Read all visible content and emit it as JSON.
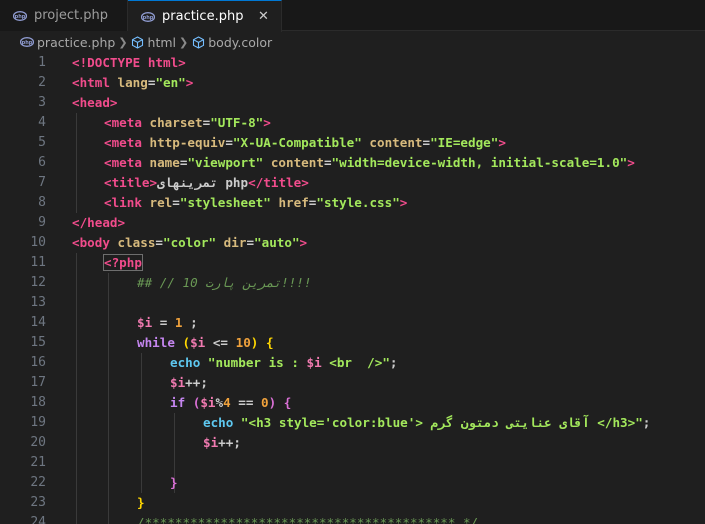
{
  "tabs": [
    {
      "label": "project.php",
      "active": false
    },
    {
      "label": "practice.php",
      "active": true,
      "close": "✕"
    }
  ],
  "breadcrumb": [
    {
      "label": "practice.php"
    },
    {
      "label": "html"
    },
    {
      "label": "body.color"
    }
  ],
  "colors": {
    "accent": "#0078d4",
    "editor_bg": "#1f1f1f",
    "tab_bg": "#181818"
  },
  "line_numbers": [
    "1",
    "2",
    "3",
    "4",
    "5",
    "6",
    "7",
    "8",
    "9",
    "10",
    "11",
    "12",
    "13",
    "14",
    "15",
    "16",
    "17",
    "18",
    "19",
    "20",
    "21",
    "22",
    "23",
    "24"
  ],
  "code": {
    "l1": {
      "a": "<!DOCTYPE",
      "b": " html",
      "c": ">"
    },
    "l2": {
      "a": "<html",
      "b": " lang",
      "c": "=",
      "d": "\"en\"",
      "e": ">"
    },
    "l3": {
      "a": "<head",
      "b": ">"
    },
    "l4": {
      "a": "<meta",
      "b": " charset",
      "c": "=",
      "d": "\"UTF-8\"",
      "e": ">"
    },
    "l5": {
      "a": "<meta",
      "b": " http-equiv",
      "c": "=",
      "d": "\"X-UA-Compatible\"",
      "e": " content",
      "f": "=",
      "g": "\"IE=edge\"",
      "h": ">"
    },
    "l6": {
      "a": "<meta",
      "b": " name",
      "c": "=",
      "d": "\"viewport\"",
      "e": " content",
      "f": "=",
      "g": "\"width=device-width, initial-scale=1.0\"",
      "h": ">"
    },
    "l7": {
      "a": "<title",
      "b": ">",
      "c": "تمرینهای php",
      "d": "</title",
      "e": ">"
    },
    "l8": {
      "a": "<link",
      "b": " rel",
      "c": "=",
      "d": "\"stylesheet\"",
      "e": " href",
      "f": "=",
      "g": "\"style.css\"",
      "h": ">"
    },
    "l9": {
      "a": "</head",
      "b": ">"
    },
    "l10": {
      "a": "<body",
      "b": " class",
      "c": "=",
      "d": "\"color\"",
      "e": " dir",
      "f": "=",
      "g": "\"auto\"",
      "h": ">"
    },
    "l11": {
      "a": "<?php"
    },
    "l12": {
      "a": "## // 10 تمرین پارت!!!!"
    },
    "l14": {
      "a": "$i",
      "b": " = ",
      "c": "1",
      "d": " ;"
    },
    "l15": {
      "a": "while",
      "b": " (",
      "c": "$i",
      "d": " <= ",
      "e": "10",
      "f": ") {"
    },
    "l16": {
      "a": "echo",
      "b": " \"number is : ",
      "c": "$i",
      "d": " <br  />\"",
      "e": ";"
    },
    "l17": {
      "a": "$i",
      "b": "++;"
    },
    "l18": {
      "a": "if",
      "b": " (",
      "c": "$i",
      "d": "%",
      "e": "4",
      "f": " == ",
      "g": "0",
      "h": ") {"
    },
    "l19": {
      "a": "echo",
      "b": " \"<h3 style='color:blue'> آقای عنایتی دمتون گرم </h3>\"",
      "c": ";"
    },
    "l20": {
      "a": "$i",
      "b": "++;"
    },
    "l22": {
      "a": "}"
    },
    "l23": {
      "a": "}"
    },
    "l24": {
      "a": "/***************************************** */"
    }
  }
}
